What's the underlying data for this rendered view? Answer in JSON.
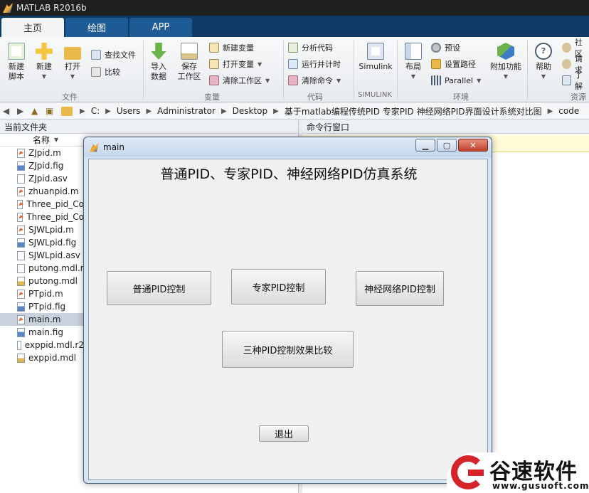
{
  "window": {
    "title": "MATLAB R2016b"
  },
  "tabs": [
    "主页",
    "绘图",
    "APP"
  ],
  "ribbon": {
    "file": {
      "group_label": "文件",
      "new_script": "新建\n脚本",
      "new": "新建",
      "open": "打开",
      "find_files": "查找文件",
      "compare": "比较"
    },
    "variable": {
      "group_label": "变量",
      "import_data": "导入\n数据",
      "save_workspace": "保存\n工作区",
      "new_variable": "新建变量",
      "open_variable": "打开变量",
      "clear_workspace": "清除工作区"
    },
    "code": {
      "group_label": "代码",
      "analyze_code": "分析代码",
      "run_and_time": "运行并计时",
      "clear_commands": "清除命令"
    },
    "simulink": {
      "group_label": "SIMULINK",
      "simulink": "Simulink"
    },
    "environment": {
      "group_label": "环境",
      "layout": "布局",
      "preferences": "预设",
      "set_path": "设置路径",
      "parallel": "Parallel",
      "add_ons": "附加功能"
    },
    "resources": {
      "group_label": "资源",
      "help": "帮助",
      "community": "社区",
      "request_support": "请求",
      "learn": "了解"
    }
  },
  "address_bar": {
    "path": [
      "C:",
      "Users",
      "Administrator",
      "Desktop",
      "基于matlab编程传统PID 专家PID 神经网络PID界面设计系统对比图",
      "code"
    ]
  },
  "current_folder": {
    "title": "当前文件夹",
    "column_name": "名称",
    "files": [
      {
        "name": "ZJpid.m",
        "icon": "m-file-icon"
      },
      {
        "name": "ZJpid.fig",
        "icon": "fig-file-icon"
      },
      {
        "name": "ZJpid.asv",
        "icon": "asv-file-icon"
      },
      {
        "name": "zhuanpid.m",
        "icon": "m-file-icon"
      },
      {
        "name": "Three_pid_Co",
        "icon": "m-file-icon"
      },
      {
        "name": "Three_pid_Co",
        "icon": "m-file-icon"
      },
      {
        "name": "SJWLpid.m",
        "icon": "m-file-icon"
      },
      {
        "name": "SJWLpid.fig",
        "icon": "fig-file-icon"
      },
      {
        "name": "SJWLpid.asv",
        "icon": "asv-file-icon"
      },
      {
        "name": "putong.mdl.r",
        "icon": "asv-file-icon"
      },
      {
        "name": "putong.mdl",
        "icon": "mdl-file-icon"
      },
      {
        "name": "PTpid.m",
        "icon": "m-file-icon"
      },
      {
        "name": "PTpid.fig",
        "icon": "fig-file-icon"
      },
      {
        "name": "main.m",
        "icon": "m-file-icon",
        "selected": true
      },
      {
        "name": "main.fig",
        "icon": "fig-file-icon"
      },
      {
        "name": "exppid.mdl.r2",
        "icon": "asv-file-icon"
      },
      {
        "name": "exppid.mdl",
        "icon": "mdl-file-icon"
      }
    ]
  },
  "command_window": {
    "title": "命令行窗口"
  },
  "dialog": {
    "title": "main",
    "heading": "普通PID、专家PID、神经网络PID仿真系统",
    "btn_normal_pid": "普通PID控制",
    "btn_expert_pid": "专家PID控制",
    "btn_neural_pid": "神经网络PID控制",
    "btn_compare": "三种PID控制效果比较",
    "btn_exit": "退出"
  },
  "watermark": {
    "brand": "谷速软件",
    "url": "www.gusuoft.com"
  }
}
